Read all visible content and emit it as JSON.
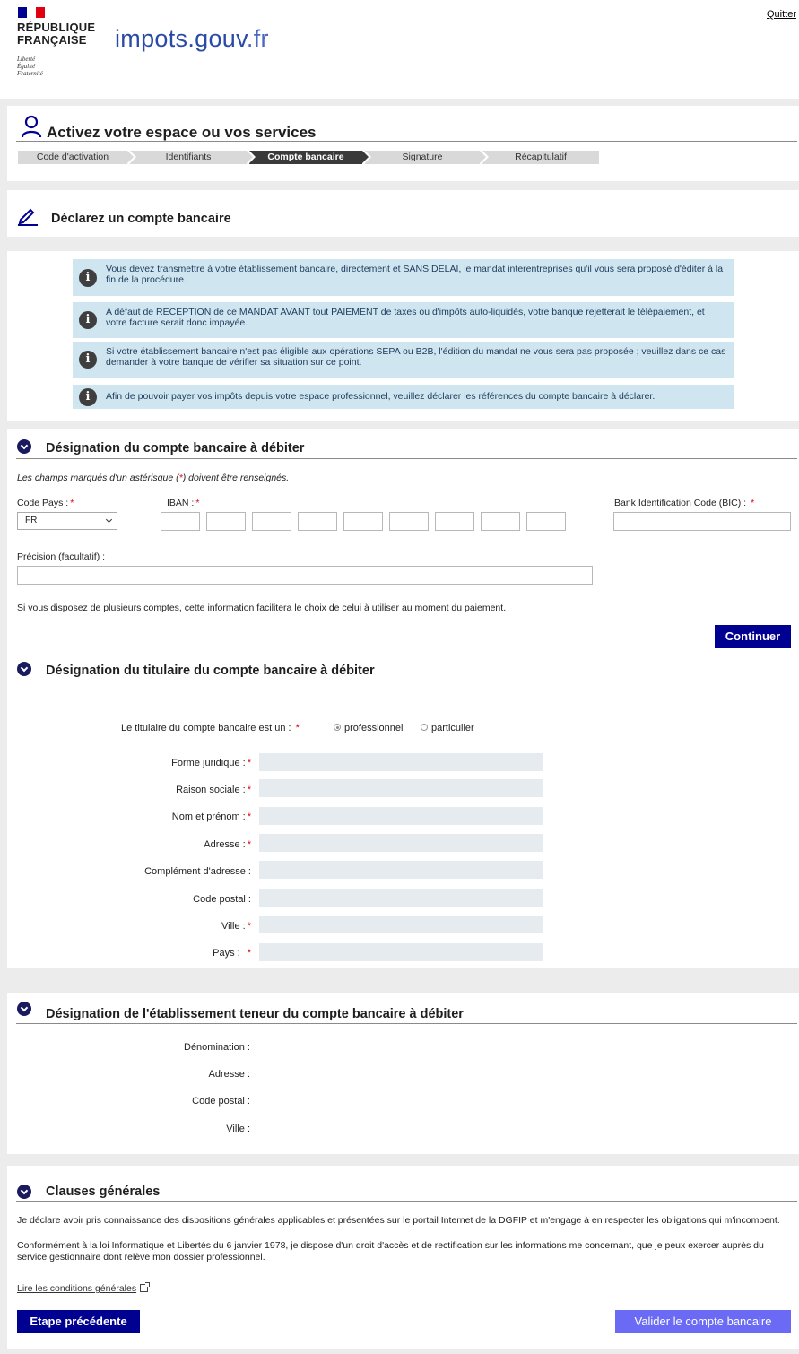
{
  "header": {
    "republique_line1": "RÉPUBLIQUE",
    "republique_line2": "FRANÇAISE",
    "motto1": "Liberté",
    "motto2": "Égalité",
    "motto3": "Fraternité",
    "brand_impots": "impots",
    "brand_dot": ".",
    "brand_gouv": "gouv",
    "brand_fr": ".fr",
    "quit_label": "Quitter"
  },
  "main": {
    "title": "Activez votre espace ou vos services",
    "steps": [
      {
        "label": "Code d'activation",
        "active": false
      },
      {
        "label": "Identifiants",
        "active": false
      },
      {
        "label": "Compte bancaire",
        "active": true
      },
      {
        "label": "Signature",
        "active": false
      },
      {
        "label": "Récapitulatif",
        "active": false
      }
    ]
  },
  "declare": {
    "title": "Déclarez un compte bancaire"
  },
  "infos": [
    "Vous devez transmettre à votre établissement bancaire, directement et SANS DELAI, le mandat interentreprises qu'il vous sera proposé d'éditer à la fin de la procédure.",
    "A défaut de RECEPTION de ce MANDAT AVANT tout PAIEMENT de taxes ou d'impôts auto-liquidés, votre banque rejetterait le télépaiement, et votre facture serait donc impayée.",
    "Si votre établissement bancaire n'est pas éligible aux opérations SEPA ou B2B, l'édition du mandat ne vous sera pas proposée ; veuillez dans ce cas demander à votre banque de vérifier sa situation sur ce point.",
    "Afin de pouvoir payer vos impôts depuis votre espace professionnel, veuillez déclarer les références du compte bancaire à déclarer."
  ],
  "account": {
    "title": "Désignation du compte bancaire à débiter",
    "required_note_a": "Les champs marqués d'un astérisque (",
    "required_note_star": "*",
    "required_note_b": ") doivent être renseignés.",
    "code_pays_label": "Code Pays :",
    "code_pays_value": "FR",
    "iban_label": "IBAN :",
    "bic_label": "Bank Identification Code (BIC) :",
    "precision_label": "Précision (facultatif) :",
    "help_text": "Si vous disposez de plusieurs comptes, cette information facilitera le choix de celui à utiliser au moment du paiement.",
    "continue_label": "Continuer",
    "star": "*"
  },
  "holder": {
    "title": "Désignation du titulaire du compte bancaire à débiter",
    "type_label": "Le titulaire du compte bancaire est un :",
    "option_pro": "professionnel",
    "option_part": "particulier",
    "selected": "professionnel",
    "fields": [
      {
        "label": "Forme juridique :",
        "required": true
      },
      {
        "label": "Raison sociale :",
        "required": true
      },
      {
        "label": "Nom et prénom :",
        "required": true
      },
      {
        "label": "Adresse :",
        "required": true
      },
      {
        "label": "Complément d'adresse :",
        "required": false
      },
      {
        "label": "Code postal :",
        "required": false
      },
      {
        "label": "Ville :",
        "required": true
      },
      {
        "label": "Pays :",
        "required": true
      }
    ]
  },
  "bank": {
    "title": "Désignation de l'établissement teneur du compte bancaire à débiter",
    "fields": [
      "Dénomination :",
      "Adresse :",
      "Code postal :",
      "Ville :"
    ]
  },
  "clauses": {
    "title": "Clauses générales",
    "para1": "Je déclare avoir pris connaissance des dispositions générales applicables et présentées sur le portail Internet de la DGFIP et m'engage à en respecter les obligations qui m'incombent.",
    "para2": "Conformément à la loi Informatique et Libertés du 6 janvier 1978, je dispose d'un droit d'accès et de rectification sur les informations me concernant, que je peux exercer auprès du service gestionnaire dont relève mon dossier professionnel.",
    "link": "Lire les conditions générales",
    "prev_label": "Etape précédente",
    "validate_label": "Valider le compte bancaire"
  },
  "colors": {
    "primary": "#000091",
    "secondary": "#6a6af4",
    "info_bg": "#cfe6f0",
    "required": "#e1000f"
  }
}
